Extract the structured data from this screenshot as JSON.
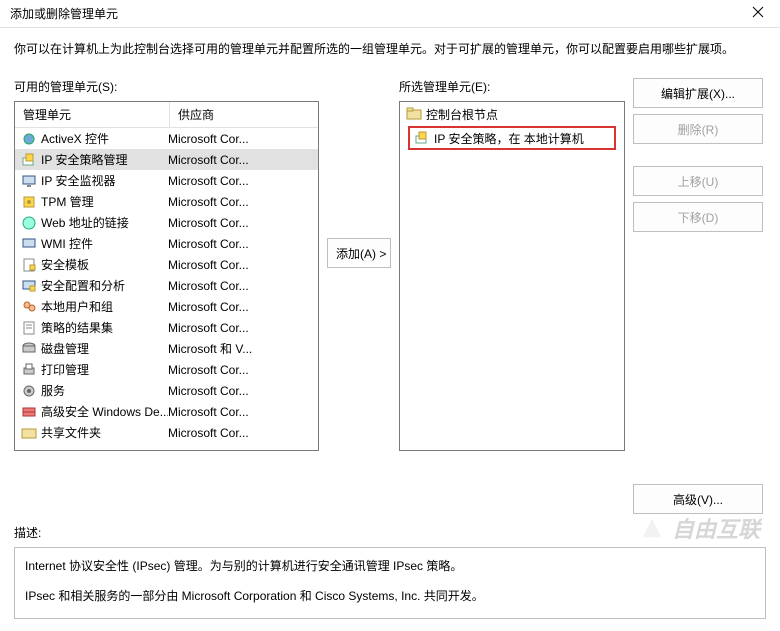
{
  "window": {
    "title": "添加或删除管理单元"
  },
  "instructions": "你可以在计算机上为此控制台选择可用的管理单元并配置所选的一组管理单元。对于可扩展的管理单元，你可以配置要启用哪些扩展项。",
  "available": {
    "label": "可用的管理单元(S):",
    "columns": {
      "snapin": "管理单元",
      "vendor": "供应商"
    },
    "items": [
      {
        "name": "ActiveX 控件",
        "vendor": "Microsoft Cor...",
        "icon": "activex-icon",
        "selected": false
      },
      {
        "name": "IP 安全策略管理",
        "vendor": "Microsoft Cor...",
        "icon": "ipsec-policy-icon",
        "selected": true
      },
      {
        "name": "IP 安全监视器",
        "vendor": "Microsoft Cor...",
        "icon": "ipsec-monitor-icon",
        "selected": false
      },
      {
        "name": "TPM 管理",
        "vendor": "Microsoft Cor...",
        "icon": "tpm-icon",
        "selected": false
      },
      {
        "name": "Web 地址的链接",
        "vendor": "Microsoft Cor...",
        "icon": "web-link-icon",
        "selected": false
      },
      {
        "name": "WMI 控件",
        "vendor": "Microsoft Cor...",
        "icon": "wmi-icon",
        "selected": false
      },
      {
        "name": "安全模板",
        "vendor": "Microsoft Cor...",
        "icon": "security-template-icon",
        "selected": false
      },
      {
        "name": "安全配置和分析",
        "vendor": "Microsoft Cor...",
        "icon": "security-config-icon",
        "selected": false
      },
      {
        "name": "本地用户和组",
        "vendor": "Microsoft Cor...",
        "icon": "users-groups-icon",
        "selected": false
      },
      {
        "name": "策略的结果集",
        "vendor": "Microsoft Cor...",
        "icon": "rsop-icon",
        "selected": false
      },
      {
        "name": "磁盘管理",
        "vendor": "Microsoft 和 V...",
        "icon": "disk-mgmt-icon",
        "selected": false
      },
      {
        "name": "打印管理",
        "vendor": "Microsoft Cor...",
        "icon": "print-mgmt-icon",
        "selected": false
      },
      {
        "name": "服务",
        "vendor": "Microsoft Cor...",
        "icon": "services-icon",
        "selected": false
      },
      {
        "name": "高级安全 Windows De...",
        "vendor": "Microsoft Cor...",
        "icon": "firewall-icon",
        "selected": false
      },
      {
        "name": "共享文件夹",
        "vendor": "Microsoft Cor...",
        "icon": "shared-folders-icon",
        "selected": false
      }
    ]
  },
  "selected": {
    "label": "所选管理单元(E):",
    "root": "控制台根节点",
    "items": [
      {
        "name": "IP 安全策略，在 本地计算机",
        "icon": "ipsec-policy-icon"
      }
    ]
  },
  "buttons": {
    "add": "添加(A) >",
    "edit_ext": "编辑扩展(X)...",
    "remove": "删除(R)",
    "move_up": "上移(U)",
    "move_down": "下移(D)",
    "advanced": "高级(V)..."
  },
  "description": {
    "label": "描述:",
    "line1": "Internet 协议安全性 (IPsec) 管理。为与别的计算机进行安全通讯管理 IPsec 策略。",
    "line2": "IPsec 和相关服务的一部分由 Microsoft Corporation 和 Cisco Systems, Inc. 共同开发。"
  },
  "watermark": "自由互联"
}
